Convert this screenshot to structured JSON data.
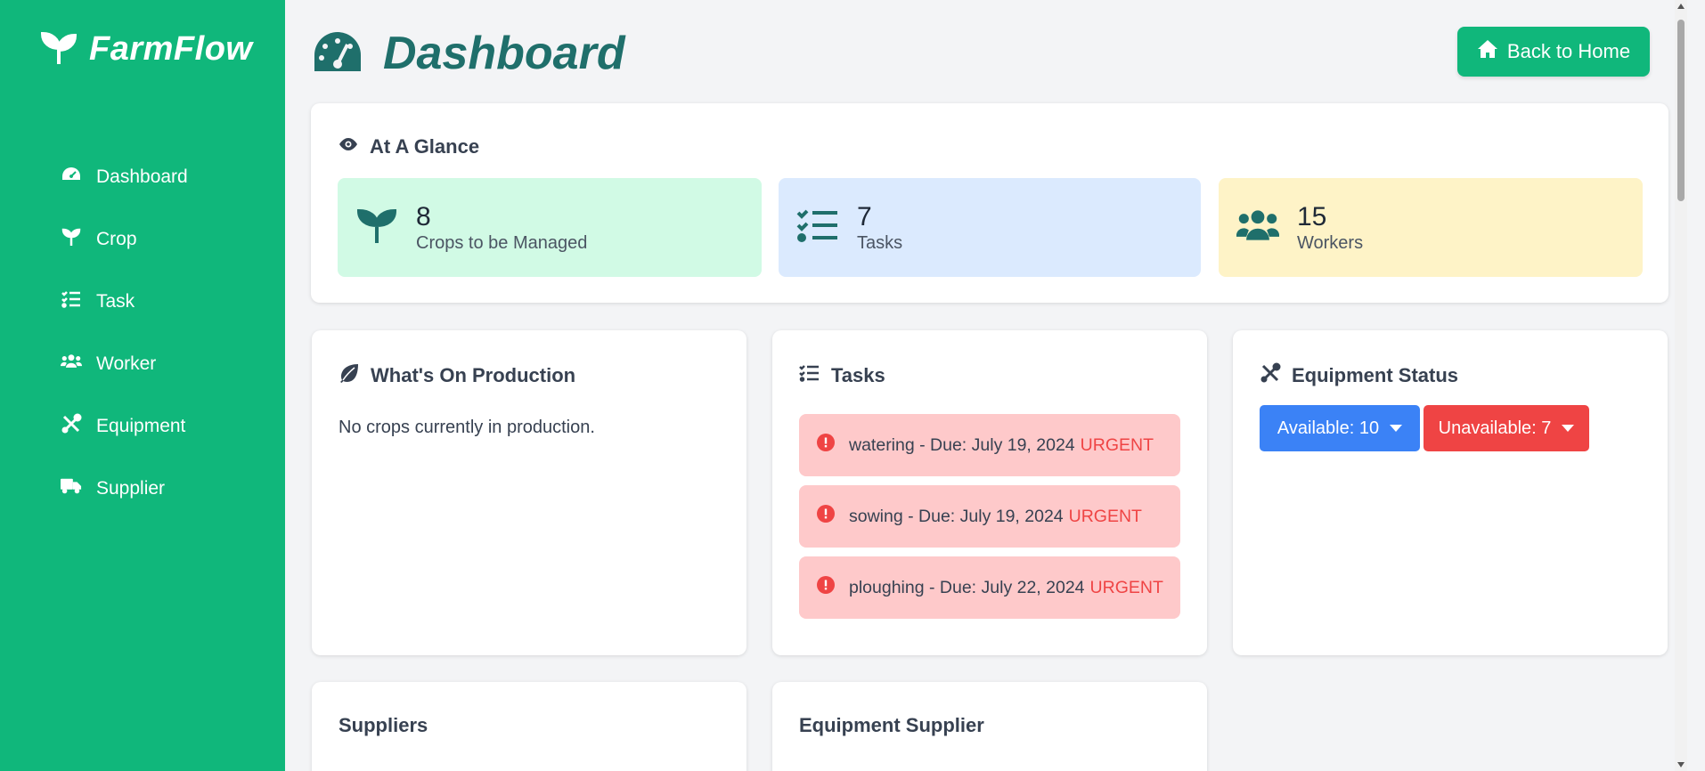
{
  "brand": {
    "name": "FarmFlow"
  },
  "sidebar": {
    "items": [
      {
        "label": "Dashboard",
        "icon": "gauge-icon"
      },
      {
        "label": "Crop",
        "icon": "seedling-icon"
      },
      {
        "label": "Task",
        "icon": "list-check-icon"
      },
      {
        "label": "Worker",
        "icon": "users-icon"
      },
      {
        "label": "Equipment",
        "icon": "tools-icon"
      },
      {
        "label": "Supplier",
        "icon": "truck-icon"
      }
    ]
  },
  "header": {
    "title": "Dashboard",
    "back_label": "Back to Home"
  },
  "glance": {
    "title": "At A Glance",
    "stats": [
      {
        "value": "8",
        "label": "Crops to be Managed",
        "bg": "#d1fae5"
      },
      {
        "value": "7",
        "label": "Tasks",
        "bg": "#dbeafe"
      },
      {
        "value": "15",
        "label": "Workers",
        "bg": "#fef3c7"
      }
    ]
  },
  "production": {
    "title": "What's On Production",
    "empty": "No crops currently in production."
  },
  "tasks": {
    "title": "Tasks",
    "items": [
      {
        "text": "watering - Due: July 19, 2024",
        "flag": "URGENT"
      },
      {
        "text": "sowing - Due: July 19, 2024",
        "flag": "URGENT"
      },
      {
        "text": "ploughing - Due: July 22, 2024",
        "flag": "URGENT"
      }
    ]
  },
  "equipment": {
    "title": "Equipment Status",
    "available": "Available: 10",
    "unavailable": "Unavailable: 7"
  },
  "suppliers": {
    "title": "Suppliers"
  },
  "equipment_supplier": {
    "title": "Equipment Supplier"
  },
  "colors": {
    "brand_green": "#10b77b",
    "title_teal": "#1f6f6b",
    "urgent_red": "#ef4444",
    "available_blue": "#3b82f6",
    "unavailable_red": "#ef4444",
    "task_bg": "#fec9ca"
  }
}
